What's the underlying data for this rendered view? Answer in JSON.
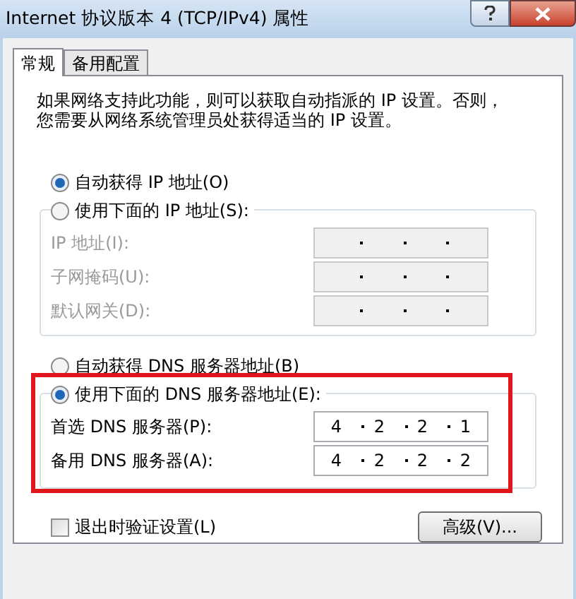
{
  "window": {
    "title": "Internet 协议版本 4 (TCP/IPv4) 属性"
  },
  "tabs": [
    {
      "label": "常规",
      "selected": true
    },
    {
      "label": "备用配置",
      "selected": false
    }
  ],
  "description": "如果网络支持此功能，则可以获取自动指派的 IP 设置。否则，您需要从网络系统管理员处获得适当的 IP 设置。",
  "ip_auto": {
    "label": "自动获得 IP 地址(O)",
    "selected": true
  },
  "ip_manual": {
    "label": "使用下面的 IP 地址(S):",
    "selected": false,
    "fields": [
      {
        "label": "IP 地址(I):",
        "disabled": true
      },
      {
        "label": "子网掩码(U):",
        "disabled": true
      },
      {
        "label": "默认网关(D):",
        "disabled": true
      }
    ]
  },
  "dns_auto": {
    "label": "自动获得 DNS 服务器地址(B)",
    "selected": false
  },
  "dns_manual": {
    "label": "使用下面的 DNS 服务器地址(E):",
    "selected": true,
    "fields": [
      {
        "label": "首选 DNS 服务器(P):",
        "disabled": false,
        "octets": [
          "4",
          "2",
          "2",
          "1"
        ]
      },
      {
        "label": "备用 DNS 服务器(A):",
        "disabled": false,
        "octets": [
          "4",
          "2",
          "2",
          "2"
        ]
      }
    ]
  },
  "validate": {
    "label": "退出时验证设置(L)",
    "checked": false
  },
  "advanced_button": "高级(V)..."
}
